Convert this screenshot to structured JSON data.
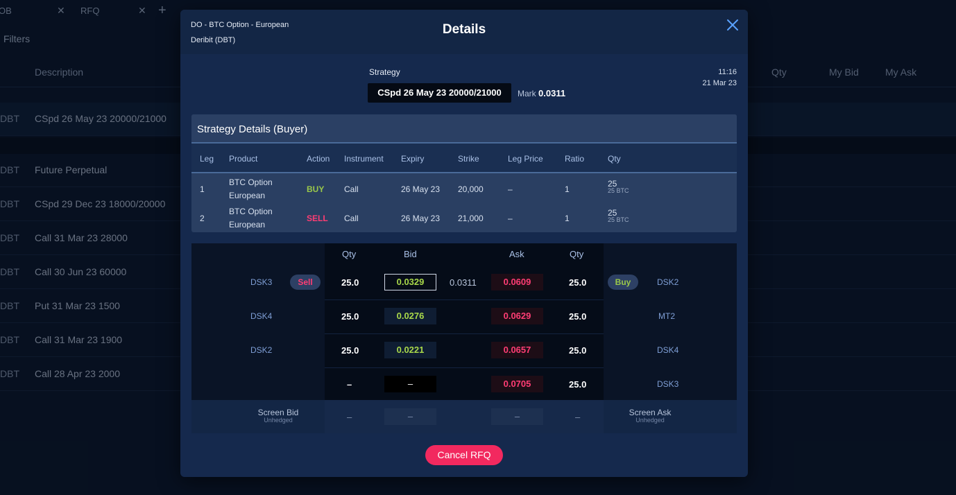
{
  "background": {
    "tabs": [
      {
        "label": "OB"
      },
      {
        "label": "RFQ"
      }
    ],
    "filters_label": "Filters",
    "headers": {
      "description": "Description",
      "qty": "Qty",
      "my_bid": "My Bid",
      "my_ask": "My Ask"
    },
    "rows": [
      {
        "exchange": "DBT",
        "description": "CSpd 26 May 23 20000/21000"
      },
      {
        "exchange": "DBT",
        "description": "Future Perpetual"
      },
      {
        "exchange": "DBT",
        "description": "CSpd 29 Dec 23 18000/20000"
      },
      {
        "exchange": "DBT",
        "description": "Call 31 Mar 23 28000"
      },
      {
        "exchange": "DBT",
        "description": "Call 30 Jun 23 60000"
      },
      {
        "exchange": "DBT",
        "description": "Put 31 Mar 23 1500"
      },
      {
        "exchange": "DBT",
        "description": "Call 31 Mar 23 1900"
      },
      {
        "exchange": "DBT",
        "description": "Call 28 Apr 23 2000"
      }
    ]
  },
  "modal": {
    "header_line1": "DO - BTC Option - European",
    "header_line2": "Deribit (DBT)",
    "title": "Details",
    "strategy_label": "Strategy",
    "strategy_value": "CSpd 26 May 23 20000/21000",
    "mark_label": "Mark",
    "mark_value": "0.0311",
    "time": "11:16",
    "date": "21 Mar 23",
    "strategy_details": {
      "title": "Strategy Details (Buyer)",
      "columns": [
        "Leg",
        "Product",
        "Action",
        "Instrument",
        "Expiry",
        "Strike",
        "Leg Price",
        "Ratio",
        "Qty"
      ],
      "rows": [
        {
          "leg": "1",
          "product_1": "BTC Option",
          "product_2": "European",
          "action": "BUY",
          "instrument": "Call",
          "expiry": "26 May 23",
          "strike": "20,000",
          "leg_price": "–",
          "ratio": "1",
          "qty": "25",
          "qty_sub": "25 BTC"
        },
        {
          "leg": "2",
          "product_1": "BTC Option",
          "product_2": "European",
          "action": "SELL",
          "instrument": "Call",
          "expiry": "26 May 23",
          "strike": "21,000",
          "leg_price": "–",
          "ratio": "1",
          "qty": "25",
          "qty_sub": "25 BTC"
        }
      ]
    },
    "orderbook": {
      "headers": {
        "qty_bid": "Qty",
        "bid": "Bid",
        "ask": "Ask",
        "qty_ask": "Qty"
      },
      "sell_button": "Sell",
      "buy_button": "Buy",
      "mark_mid": "0.0311",
      "rows": [
        {
          "bid_dealer": "DSK3",
          "bid_qty": "25.0",
          "bid": "0.0329",
          "ask": "0.0609",
          "ask_qty": "25.0",
          "ask_dealer": "DSK2"
        },
        {
          "bid_dealer": "DSK4",
          "bid_qty": "25.0",
          "bid": "0.0276",
          "ask": "0.0629",
          "ask_qty": "25.0",
          "ask_dealer": "MT2"
        },
        {
          "bid_dealer": "DSK2",
          "bid_qty": "25.0",
          "bid": "0.0221",
          "ask": "0.0657",
          "ask_qty": "25.0",
          "ask_dealer": "DSK4"
        },
        {
          "bid_dealer": "",
          "bid_qty": "–",
          "bid": "–",
          "ask": "0.0705",
          "ask_qty": "25.0",
          "ask_dealer": "DSK3"
        }
      ],
      "screen": {
        "bid_label": "Screen Bid",
        "bid_sub": "Unhedged",
        "ask_label": "Screen Ask",
        "ask_sub": "Unhedged",
        "bid_qty": "–",
        "bid": "–",
        "ask": "–",
        "ask_qty": "–"
      }
    },
    "cancel_button": "Cancel RFQ"
  },
  "colors": {
    "buy": "#9ac84a",
    "sell": "#ff3d74",
    "cancel": "#f2295f",
    "modal_bg": "#15294d"
  }
}
